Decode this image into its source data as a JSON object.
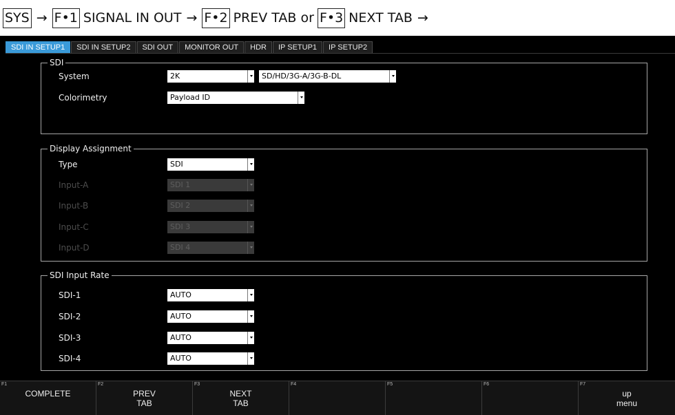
{
  "nav": {
    "sys": "SYS",
    "arrow": "→",
    "f1": "F•1",
    "f1_text": "SIGNAL IN OUT",
    "f2": "F•2",
    "f2_text": "PREV TAB or",
    "f3": "F•3",
    "f3_text": "NEXT TAB"
  },
  "tabs": [
    {
      "label": "SDI IN SETUP1",
      "active": true
    },
    {
      "label": "SDI IN SETUP2",
      "active": false
    },
    {
      "label": "SDI OUT",
      "active": false
    },
    {
      "label": "MONITOR OUT",
      "active": false
    },
    {
      "label": "HDR",
      "active": false
    },
    {
      "label": "IP SETUP1",
      "active": false
    },
    {
      "label": "IP SETUP2",
      "active": false
    }
  ],
  "sdi": {
    "title": "SDI",
    "system_label": "System",
    "system_value": "2K",
    "system_mode": "SD/HD/3G-A/3G-B-DL",
    "colorimetry_label": "Colorimetry",
    "colorimetry_value": "Payload ID"
  },
  "display": {
    "title": "Display Assignment",
    "rows": [
      {
        "label": "Type",
        "value": "SDI",
        "enabled": true
      },
      {
        "label": "Input-A",
        "value": "SDI 1",
        "enabled": false
      },
      {
        "label": "Input-B",
        "value": "SDI 2",
        "enabled": false
      },
      {
        "label": "Input-C",
        "value": "SDI 3",
        "enabled": false
      },
      {
        "label": "Input-D",
        "value": "SDI 4",
        "enabled": false
      }
    ]
  },
  "rate": {
    "title": "SDI Input Rate",
    "rows": [
      {
        "label": "SDI-1",
        "value": "AUTO"
      },
      {
        "label": "SDI-2",
        "value": "AUTO"
      },
      {
        "label": "SDI-3",
        "value": "AUTO"
      },
      {
        "label": "SDI-4",
        "value": "AUTO"
      }
    ]
  },
  "fkeys": [
    {
      "num": "F1",
      "line1": "COMPLETE",
      "line2": ""
    },
    {
      "num": "F2",
      "line1": "PREV",
      "line2": "TAB"
    },
    {
      "num": "F3",
      "line1": "NEXT",
      "line2": "TAB"
    },
    {
      "num": "F4",
      "line1": "",
      "line2": ""
    },
    {
      "num": "F5",
      "line1": "",
      "line2": ""
    },
    {
      "num": "F6",
      "line1": "",
      "line2": ""
    },
    {
      "num": "F7",
      "line1": "up",
      "line2": "menu"
    }
  ],
  "colors": {
    "active_tab": "#3a9ad9",
    "screen_bg": "#000000",
    "group_border": "#a8a8a8"
  }
}
